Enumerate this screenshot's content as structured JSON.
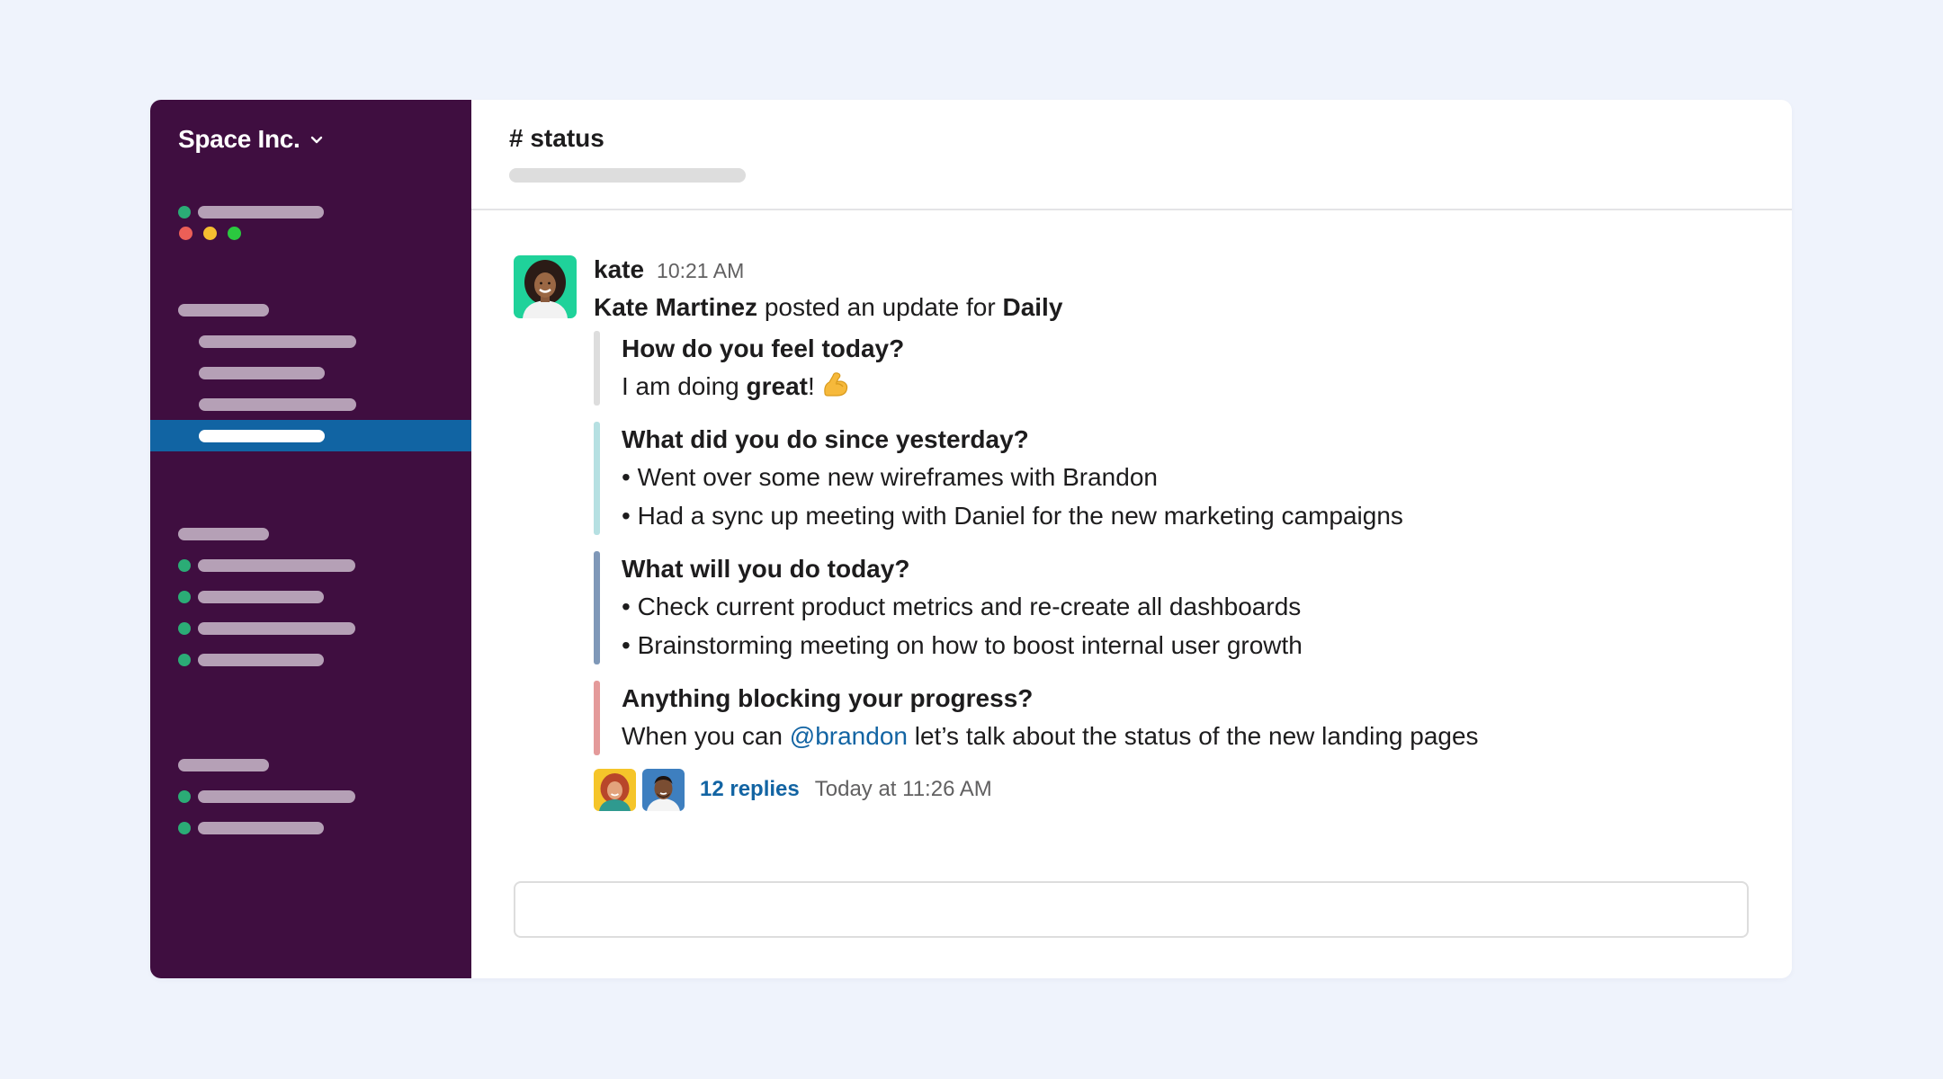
{
  "colors": {
    "sidebar_bg": "#3f0e40",
    "selected_bg": "#1164a3",
    "presence_green": "#2bac76",
    "link_blue": "#1264a3",
    "traffic": [
      "#ec5f57",
      "#f5be30",
      "#2bc93f"
    ],
    "stripes": [
      "#dddddd",
      "#b6e0e2",
      "#7f98b8",
      "#e49a9a"
    ]
  },
  "sidebar": {
    "workspace_name": "Space Inc.",
    "workspace_icon": "chevron-down-icon"
  },
  "channel": {
    "title": "# status"
  },
  "message": {
    "author": "kate",
    "time": "10:21 AM",
    "poster_name": "Kate Martinez",
    "posted_text": "posted an update for",
    "report_name": "Daily",
    "sections": [
      {
        "question": "How do you feel today?",
        "answer_prefix": "I am doing ",
        "answer_bold": "great",
        "answer_suffix": "!",
        "emoji": "flexed-biceps-icon"
      },
      {
        "question": "What did you do since yesterday?",
        "items": [
          "• Went over some new wireframes with Brandon",
          "• Had a sync up meeting with Daniel for the new marketing campaigns"
        ]
      },
      {
        "question": "What will you do today?",
        "items": [
          "• Check current product metrics and re-create all dashboards",
          "• Brainstorming meeting on how to boost internal user growth"
        ]
      },
      {
        "question": "Anything blocking your progress?",
        "answer_prefix": "When you can ",
        "mention": "@brandon",
        "answer_suffix": " let’s talk about the status of the new landing pages"
      }
    ],
    "thread": {
      "replies": "12 replies",
      "last_reply": "Today at 11:26 AM"
    }
  }
}
